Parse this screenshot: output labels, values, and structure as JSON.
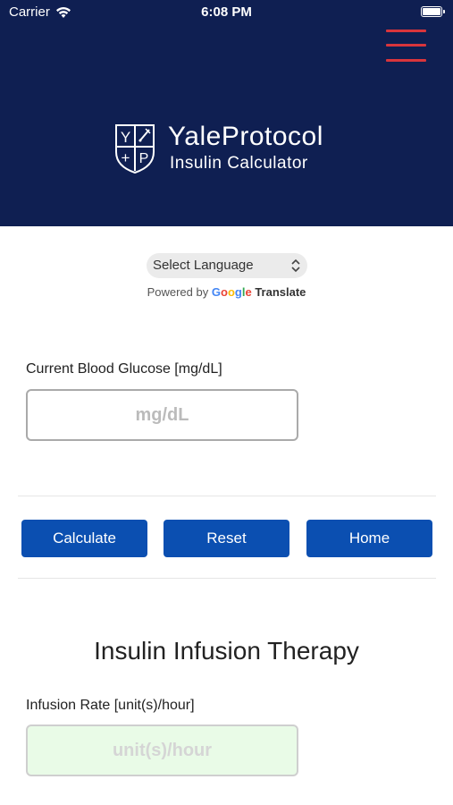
{
  "status_bar": {
    "carrier": "Carrier",
    "time": "6:08 PM"
  },
  "header": {
    "menu_icon": "hamburger-menu-icon",
    "menu_color": "#d9353c",
    "background": "#0f1f52",
    "logo": {
      "title": "YaleProtocol",
      "subtitle": "Insulin Calculator",
      "crest_letters": [
        "Y",
        "+",
        "P"
      ]
    }
  },
  "language": {
    "select_label": "Select Language",
    "powered_by": "Powered by",
    "google": "Google",
    "translate": "Translate"
  },
  "glucose": {
    "label": "Current Blood Glucose [mg/dL]",
    "placeholder": "mg/dL",
    "value": ""
  },
  "buttons": {
    "calculate": "Calculate",
    "reset": "Reset",
    "home": "Home",
    "color": "#0b4fb1"
  },
  "therapy": {
    "title": "Insulin Infusion Therapy",
    "rate_label": "Infusion Rate [unit(s)/hour]",
    "rate_placeholder": "unit(s)/hour",
    "rate_value": ""
  }
}
